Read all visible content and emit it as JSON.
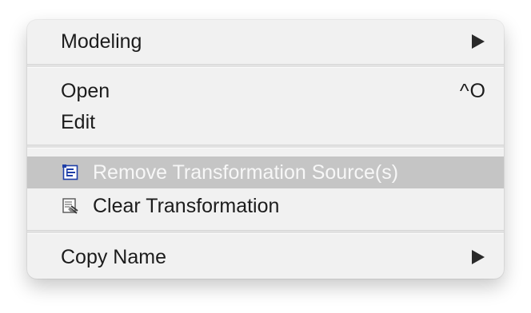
{
  "menu": {
    "items": [
      {
        "label": "Modeling",
        "submenu": true,
        "icon": "submenu-arrow-icon"
      },
      {
        "label": "Open",
        "shortcut": "^O"
      },
      {
        "label": "Edit"
      },
      {
        "label": "Remove Transformation Source(s)",
        "icon": "remove-transformation-source-icon",
        "highlighted": true
      },
      {
        "label": "Clear Transformation",
        "icon": "clear-transformation-icon"
      },
      {
        "label": "Copy Name",
        "submenu": true,
        "icon": "submenu-arrow-icon"
      }
    ]
  },
  "colors": {
    "menu_background": "#f1f1f1",
    "highlight_background": "#c5c5c5",
    "highlight_text": "#f7f7f7",
    "text": "#1c1c1c",
    "icon_blue": "#1f3fa8"
  }
}
